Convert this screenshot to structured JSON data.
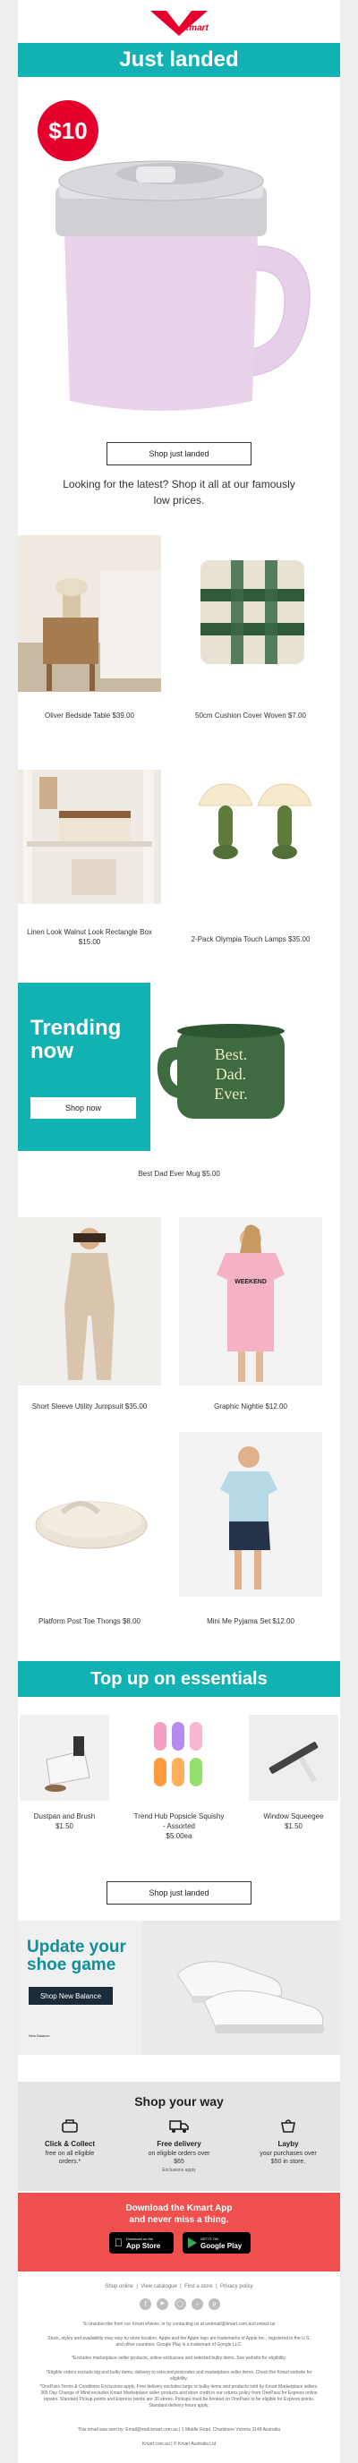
{
  "brand": {
    "name": "Kmart",
    "red": "#e4002b",
    "teal": "#12b2b4"
  },
  "hero": {
    "banner": "Just landed",
    "price_badge": "$10",
    "button": "Shop just landed",
    "tagline": "Looking for the latest? Shop it all at our famously low prices."
  },
  "products_a": [
    {
      "label": "Oliver Bedside Table $39.00"
    },
    {
      "label": "50cm Cushion Cover Woven $7.00"
    },
    {
      "label": "Linen Look Walnut Look Rectangle Box $15.00"
    },
    {
      "label": "2-Pack Olympia Touch Lamps $35.00"
    }
  ],
  "trending": {
    "title": "Trending now",
    "button": "Shop now",
    "mug_text": "Best. Dad. Ever.",
    "caption": "Best Dad Ever Mug $5.00"
  },
  "products_b": [
    {
      "label": "Short Sleeve Utility Jumpsuit $35.00"
    },
    {
      "label": "Graphic Nightie $12.00",
      "shirt_text": "WEEKEND"
    },
    {
      "label": "Platform Post Toe Thongs $8.00"
    },
    {
      "label": "Mini Me Pyjama Set $12.00"
    }
  ],
  "essentials": {
    "banner": "Top up on essentials",
    "items": [
      {
        "name": "Dustpan and Brush",
        "price": "$1.50"
      },
      {
        "name": "Trend Hub Popsicle Squishy - Assorted",
        "price": "$5.00ea"
      },
      {
        "name": "Window Squeegee",
        "price": "$1.50"
      }
    ],
    "button": "Shop just landed"
  },
  "shoe": {
    "title": "Update your shoe game",
    "button": "Shop New Balance",
    "tag": "New Balance"
  },
  "shop_your_way": {
    "title": "Shop your way",
    "options": [
      {
        "icon": "click-collect-icon",
        "title": "Click & Collect",
        "desc": "free on all eligible orders.*"
      },
      {
        "icon": "delivery-truck-icon",
        "title": "Free delivery",
        "desc": "on eligible orders over $65",
        "note": "Exclusions apply"
      },
      {
        "icon": "layby-icon",
        "title": "Layby",
        "desc": "your purchases over $50 in store."
      }
    ]
  },
  "app": {
    "line1": "Download the Kmart App",
    "line2": "and never miss a thing.",
    "app_store": "App Store",
    "google_play": "Google Play",
    "app_store_small": "Download on the",
    "google_play_small": "GET IT ON"
  },
  "footer": {
    "links": [
      "Shop online",
      "View catalogue",
      "Find a store",
      "Privacy policy"
    ],
    "social": [
      "facebook-icon",
      "youtube-icon",
      "instagram-icon",
      "tiktok-icon",
      "pinterest-icon"
    ],
    "unsubscribe": "To unsubscribe from our Kmart eNews, or by contacting us at webmail@kmart.com.au/contact-us",
    "legal1": "Stock, styles and availability may vary by store location. Apple and the Apple logo are trademarks of Apple Inc., registered in the U.S. and other countries. Google Play is a trademark of Google LLC.",
    "legal2": "*Excludes marketplace seller products, online exclusives and selected bulky items. See website for eligibility.",
    "legal3": "*Eligible orders exclude big and bulky items, delivery to selected postcodes and marketplace seller items. Check the Kmart website for eligibility.",
    "legal4": "*OnePass Terms & Conditions Exclusions apply. Free delivery excludes large or bulky items and products sold by Kmart Marketplace sellers. 365 Day Change of Mind excludes Kmart Marketplace seller products and store credit in our returns policy from OnePass for Express online repairs. Standard Pickup points and Express points are 30 stores. Pickups must be booked on OnePass to be eligible for Express points. Standard delivery hours apply.",
    "address": "This email was sent by: Email@mail.kmart.com.au | 1 Middle Road, Chadstone Victoria 3148 Australia",
    "copyright": "Kmart.com.au | © Kmart Australia Ltd"
  }
}
